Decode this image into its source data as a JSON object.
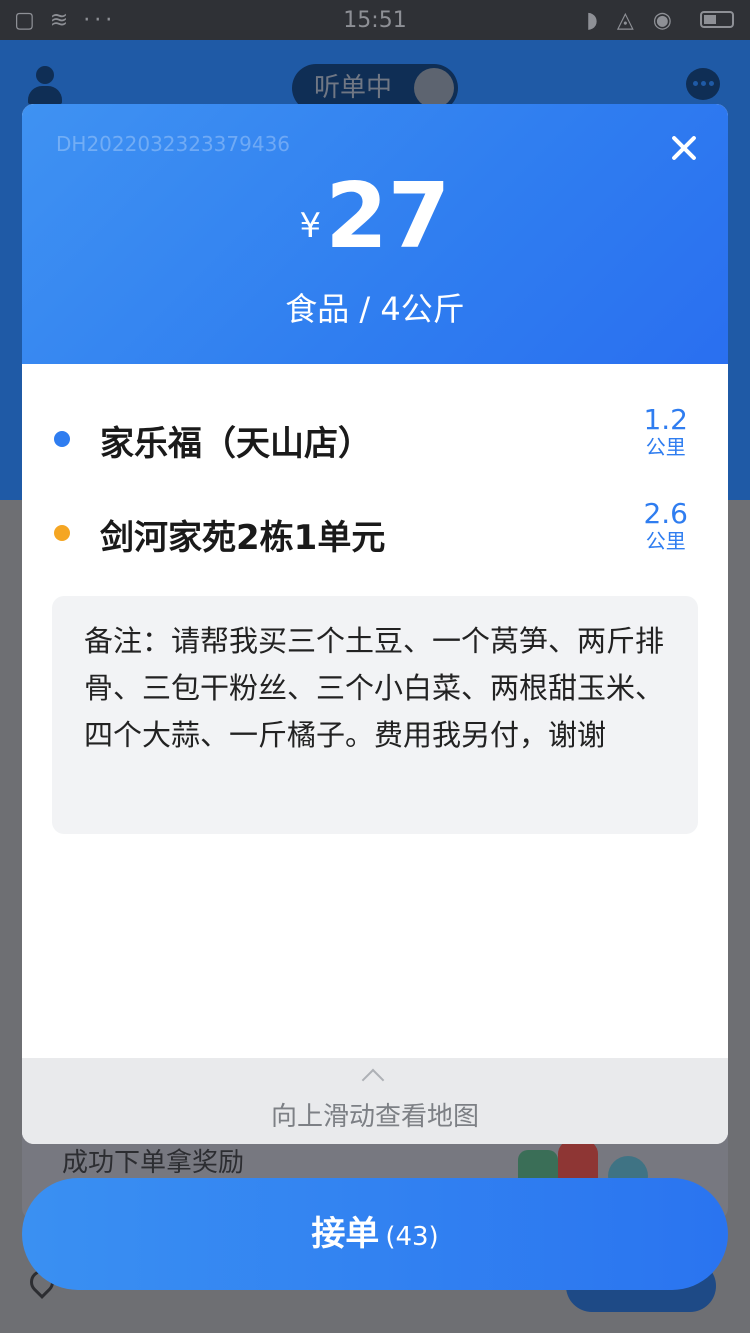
{
  "status_bar": {
    "time": "15:51"
  },
  "header": {
    "listen_label": "听单中"
  },
  "promo": {
    "text": "成功下单拿奖励"
  },
  "order": {
    "order_no": "DH2022032323379436",
    "currency": "¥",
    "price": "27",
    "goods_info": "食品 / 4公斤",
    "pickup": {
      "name": "家乐福（天山店）",
      "distance": "1.2",
      "unit": "公里",
      "color": "#2f7df0"
    },
    "dropoff": {
      "name": "剑河家苑2栋1单元",
      "distance": "2.6",
      "unit": "公里",
      "color": "#f5a623"
    },
    "note": "备注：请帮我买三个土豆、一个莴笋、两斤排骨、三包干粉丝、三个小白菜、两根甜玉米、四个大蒜、一斤橘子。费用我另付，谢谢",
    "swipe_hint": "向上滑动查看地图"
  },
  "accept": {
    "label": "接单",
    "count": "(43)"
  },
  "colors": {
    "accent": "#2f7df0",
    "header_dark": "#1f5aa6"
  }
}
